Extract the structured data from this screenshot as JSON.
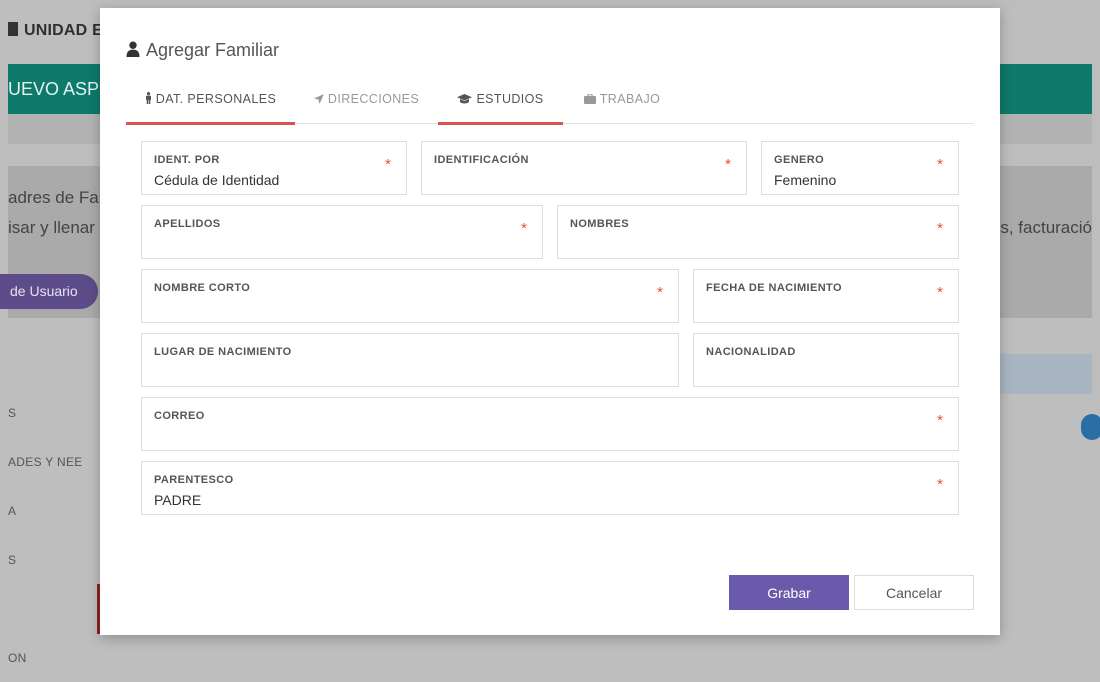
{
  "background": {
    "app_title": "UNIDAD E",
    "banner": "UEVO ASPIR",
    "text_line1": "adres de Fam",
    "text_line2": "isar y llenar",
    "text_right": "s, facturació",
    "user_button": "de Usuario",
    "side_items": [
      "S",
      "ADES Y NEE",
      "A",
      "S",
      "ON"
    ]
  },
  "modal": {
    "title": "Agregar Familiar",
    "tabs": [
      {
        "label": "DAT. PERSONALES",
        "icon": "person-standing-icon",
        "active": true
      },
      {
        "label": "DIRECCIONES",
        "icon": "location-arrow-icon",
        "active": false
      },
      {
        "label": "ESTUDIOS",
        "icon": "graduation-cap-icon",
        "active": true
      },
      {
        "label": "TRABAJO",
        "icon": "briefcase-icon",
        "active": false
      }
    ],
    "fields": {
      "ident_por": {
        "label": "IDENT. POR",
        "value": "Cédula de Identidad",
        "required": "*"
      },
      "identificacion": {
        "label": "IDENTIFICACIÓN",
        "value": "",
        "required": "*"
      },
      "genero": {
        "label": "GENERO",
        "value": "Femenino",
        "required": "*"
      },
      "apellidos": {
        "label": "APELLIDOS",
        "value": "",
        "required": "*"
      },
      "nombres": {
        "label": "NOMBRES",
        "value": "",
        "required": "*"
      },
      "nombre_corto": {
        "label": "NOMBRE CORTO",
        "value": "",
        "required": "*"
      },
      "fecha_nacimiento": {
        "label": "FECHA DE NACIMIENTO",
        "value": "",
        "required": "*"
      },
      "lugar_nacimiento": {
        "label": "LUGAR DE NACIMIENTO",
        "value": ""
      },
      "nacionalidad": {
        "label": "NACIONALIDAD",
        "value": ""
      },
      "correo": {
        "label": "CORREO",
        "value": "",
        "required": "*"
      },
      "parentesco": {
        "label": "PARENTESCO",
        "value": "PADRE",
        "required": "*"
      }
    },
    "buttons": {
      "save": "Grabar",
      "cancel": "Cancelar"
    }
  },
  "colors": {
    "primary_button": "#6a5aac",
    "tab_active_underline": "#d9534f",
    "required_mark": "#e74c3c",
    "banner_teal": "#0d7a6b"
  }
}
